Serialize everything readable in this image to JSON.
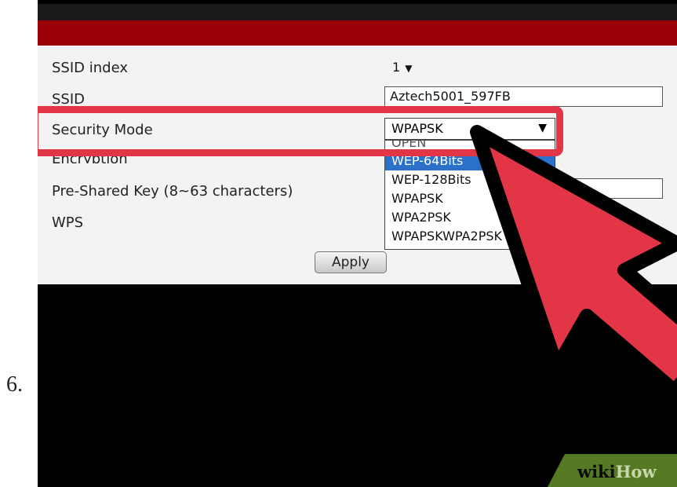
{
  "step_number": "6.",
  "form": {
    "ssid_index_label": "SSID index",
    "ssid_index_value": "1",
    "ssid_label": "SSID",
    "ssid_value": "Aztech5001_597FB",
    "security_mode_label": "Security Mode",
    "security_mode_value": "WPAPSK",
    "encryption_label": "Encryption",
    "psk_label": "Pre-Shared Key (8~63 characters)",
    "wps_label": "WPS",
    "apply_label": "Apply"
  },
  "dropdown_options": [
    {
      "label": "OPEN",
      "selected": false
    },
    {
      "label": "WEP-64Bits",
      "selected": true
    },
    {
      "label": "WEP-128Bits",
      "selected": false
    },
    {
      "label": "WPAPSK",
      "selected": false
    },
    {
      "label": "WPA2PSK",
      "selected": false
    },
    {
      "label": "WPAPSKWPA2PSK",
      "selected": false
    }
  ],
  "watermark": {
    "part1": "wiki",
    "part2": "How"
  },
  "colors": {
    "header_red": "#9b0008",
    "highlight": "#e23646",
    "selected_option": "#2b71c9",
    "arrow": "#e23646"
  }
}
